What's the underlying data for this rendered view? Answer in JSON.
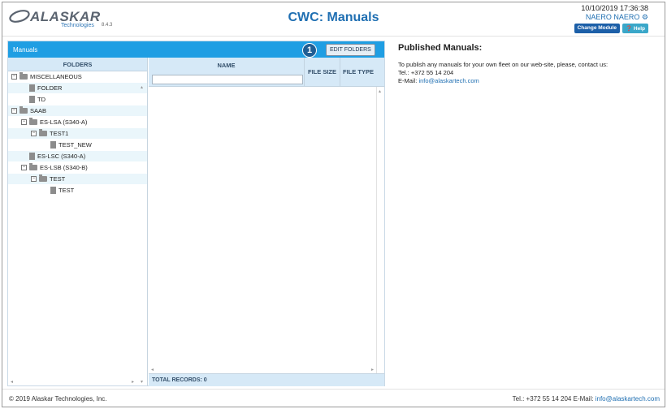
{
  "header": {
    "logo_word": "ALASKAR",
    "logo_sub": "Technologies",
    "version": "8.4.3",
    "title": "CWC: Manuals",
    "datetime": "10/10/2019 17:36:38",
    "user": "NAERO NAERO",
    "change_module": "Change Module",
    "help": "Help"
  },
  "panel": {
    "title": "Manuals",
    "edit_folders": "EDIT FOLDERS",
    "callout": "1",
    "folders_header": "FOLDERS",
    "tree": [
      {
        "label": "MISCELLANEOUS",
        "type": "folder",
        "expanded": true
      },
      {
        "label": "FOLDER",
        "type": "doc"
      },
      {
        "label": "TD",
        "type": "doc"
      },
      {
        "label": "SAAB",
        "type": "folder",
        "expanded": true
      },
      {
        "label": "ES-LSA (S340-A)",
        "type": "folder",
        "expanded": true
      },
      {
        "label": "TEST1",
        "type": "folder",
        "expanded": true
      },
      {
        "label": "TEST_NEW",
        "type": "doc"
      },
      {
        "label": "ES-LSC (S340-A)",
        "type": "doc"
      },
      {
        "label": "ES-LSB (S340-B)",
        "type": "folder",
        "expanded": true
      },
      {
        "label": "TEST",
        "type": "folder",
        "expanded": true
      },
      {
        "label": "TEST",
        "type": "doc"
      }
    ],
    "columns": {
      "name": "NAME",
      "file_size": "FILE SIZE",
      "file_type": "FILE TYPE"
    },
    "total_records": "TOTAL RECORDS: 0"
  },
  "published": {
    "title": "Published Manuals:",
    "line1": "To publish any manuals for your own fleet on our web-site, please, contact us:",
    "tel": "Tel.: +372 55 14 204",
    "email_label": "E-Mail:",
    "email": "info@alaskartech.com"
  },
  "footer": {
    "copyright": "© 2019 Alaskar Technologies, Inc.",
    "contact_text": "Tel.: +372 55 14 204 E-Mail:",
    "email": "info@alaskartech.com"
  },
  "colors": {
    "accent": "#1f9ee3",
    "title_blue": "#1f6fb2",
    "header_row": "#d6e9f7"
  }
}
